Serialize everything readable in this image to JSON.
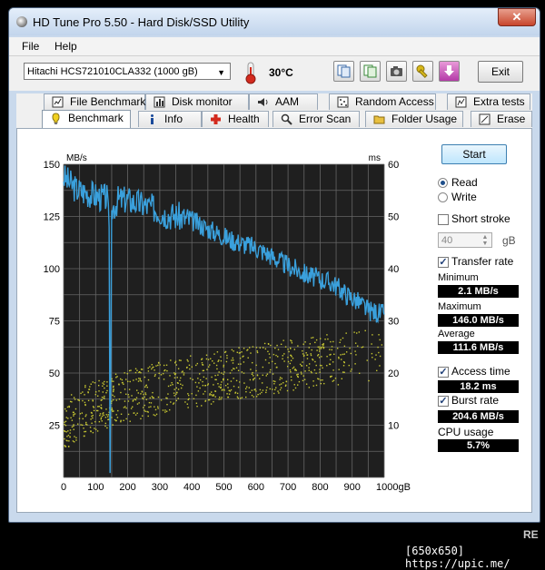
{
  "window": {
    "title": "HD Tune Pro 5.50 - Hard Disk/SSD Utility",
    "close_label": "✕"
  },
  "menu": {
    "file": "File",
    "help": "Help"
  },
  "toolbar": {
    "drive": "Hitachi HCS721010CLA332 (1000 gB)",
    "temperature": "30°C",
    "exit_label": "Exit"
  },
  "tabs_top": [
    {
      "label": "File Benchmark",
      "icon": "file-benchmark-icon"
    },
    {
      "label": "Disk monitor",
      "icon": "disk-monitor-icon"
    },
    {
      "label": "AAM",
      "icon": "speaker-icon"
    },
    {
      "label": "Random Access",
      "icon": "random-access-icon"
    },
    {
      "label": "Extra tests",
      "icon": "extra-tests-icon"
    }
  ],
  "tabs_bottom": [
    {
      "label": "Benchmark",
      "icon": "benchmark-icon"
    },
    {
      "label": "Info",
      "icon": "info-icon"
    },
    {
      "label": "Health",
      "icon": "health-icon"
    },
    {
      "label": "Error Scan",
      "icon": "error-scan-icon"
    },
    {
      "label": "Folder Usage",
      "icon": "folder-icon"
    },
    {
      "label": "Erase",
      "icon": "erase-icon"
    }
  ],
  "controls": {
    "start_label": "Start",
    "read_label": "Read",
    "write_label": "Write",
    "read_selected": true,
    "short_stroke_label": "Short stroke",
    "short_stroke_checked": false,
    "short_stroke_value": "40",
    "short_stroke_unit": "gB",
    "transfer_rate_label": "Transfer rate",
    "transfer_rate_checked": true,
    "minimum_label": "Minimum",
    "minimum_value": "2.1 MB/s",
    "maximum_label": "Maximum",
    "maximum_value": "146.0 MB/s",
    "average_label": "Average",
    "average_value": "111.6 MB/s",
    "access_time_label": "Access time",
    "access_time_checked": true,
    "access_time_value": "18.2 ms",
    "burst_rate_label": "Burst rate",
    "burst_rate_checked": true,
    "burst_rate_value": "204.6 MB/s",
    "cpu_label": "CPU usage",
    "cpu_value": "5.7%"
  },
  "chart_data": {
    "type": "line",
    "y_left_label": "MB/s",
    "y_right_label": "ms",
    "x_unit": "gB",
    "y_left_ticks": [
      "150",
      "125",
      "100",
      "75",
      "50",
      "25"
    ],
    "y_right_ticks": [
      "60",
      "50",
      "40",
      "30",
      "20",
      "10"
    ],
    "x_ticks": [
      "0",
      "100",
      "200",
      "300",
      "400",
      "500",
      "600",
      "700",
      "800",
      "900",
      "1000gB"
    ],
    "xlim": [
      0,
      1000
    ],
    "ylim_left": [
      0,
      150
    ],
    "ylim_right": [
      0,
      60
    ],
    "grid": true,
    "colors": {
      "background": "#1f1f1f",
      "grid": "#666666",
      "transfer": "#3aa0dc",
      "access": "#c8c832"
    },
    "transfer_rate_series": {
      "name": "Transfer rate",
      "x": [
        0,
        20,
        40,
        60,
        80,
        100,
        120,
        135,
        142,
        145,
        150,
        170,
        200,
        240,
        280,
        320,
        360,
        400,
        440,
        480,
        520,
        560,
        600,
        640,
        680,
        720,
        760,
        800,
        840,
        880,
        920,
        950,
        980,
        1000
      ],
      "y": [
        144,
        141,
        138,
        137,
        136,
        135,
        134,
        134,
        120,
        2.1,
        128,
        133,
        133,
        131,
        129,
        126,
        125,
        123,
        120,
        117,
        114,
        112,
        110,
        107,
        103,
        100,
        97,
        95,
        93,
        88,
        84,
        80,
        79,
        78
      ]
    },
    "access_time_series": {
      "name": "Access time",
      "x_range": [
        0,
        1000
      ],
      "y_range_ms": [
        4,
        30
      ],
      "trend_start_ms": 9,
      "trend_end_ms": 24,
      "spread_ms": 5
    }
  },
  "footer": {
    "credit": "[650x650] https://upic.me/",
    "watermark": "RE"
  }
}
